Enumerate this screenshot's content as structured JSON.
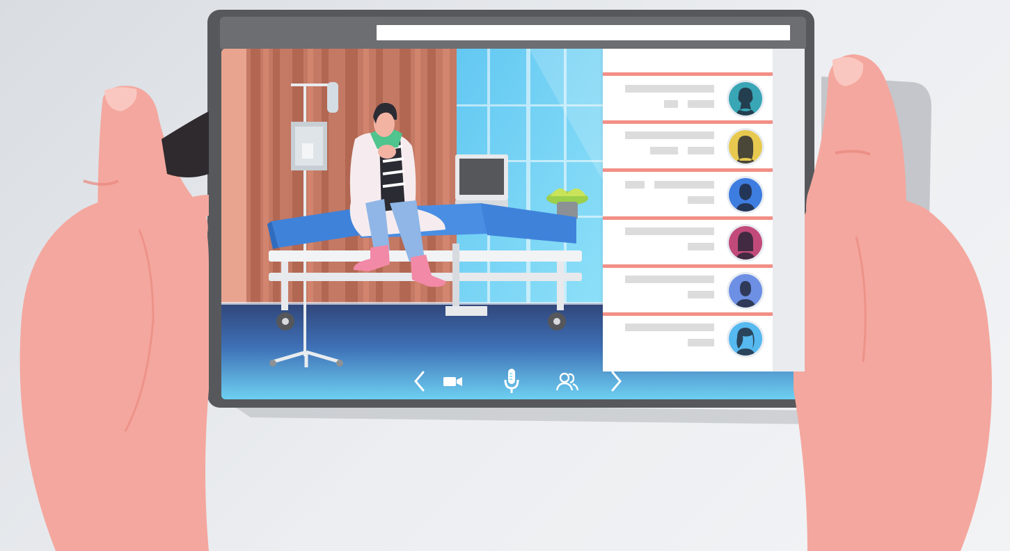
{
  "colors": {
    "background": "#e6e9ed",
    "tablet_frame": "#56585c",
    "tablet_header": "#6c6e72",
    "panel_divider": "#f28f86",
    "skin": "#f4a79e",
    "skin_shadow": "#e8867c",
    "bed_blue": "#4a8ee4",
    "floor_blue": "#3f6fb8",
    "window_blue": "#6ecff4",
    "wall": "#c47964"
  },
  "contacts": [
    {
      "avatar_bg": "#39a6b6",
      "icon": "avatar-curly-hair-icon"
    },
    {
      "avatar_bg": "#e7c94f",
      "icon": "avatar-long-hair-icon"
    },
    {
      "avatar_bg": "#3e7de0",
      "icon": "avatar-short-hair-icon"
    },
    {
      "avatar_bg": "#c24a7a",
      "icon": "avatar-bob-hair-icon"
    },
    {
      "avatar_bg": "#6d8fe4",
      "icon": "avatar-man-icon"
    },
    {
      "avatar_bg": "#56b9ef",
      "icon": "avatar-wavy-hair-icon"
    }
  ],
  "controls": [
    {
      "icon": "chevron-left-icon"
    },
    {
      "icon": "video-camera-icon"
    },
    {
      "icon": "microphone-icon"
    },
    {
      "icon": "participants-icon"
    },
    {
      "icon": "chevron-right-icon"
    }
  ]
}
